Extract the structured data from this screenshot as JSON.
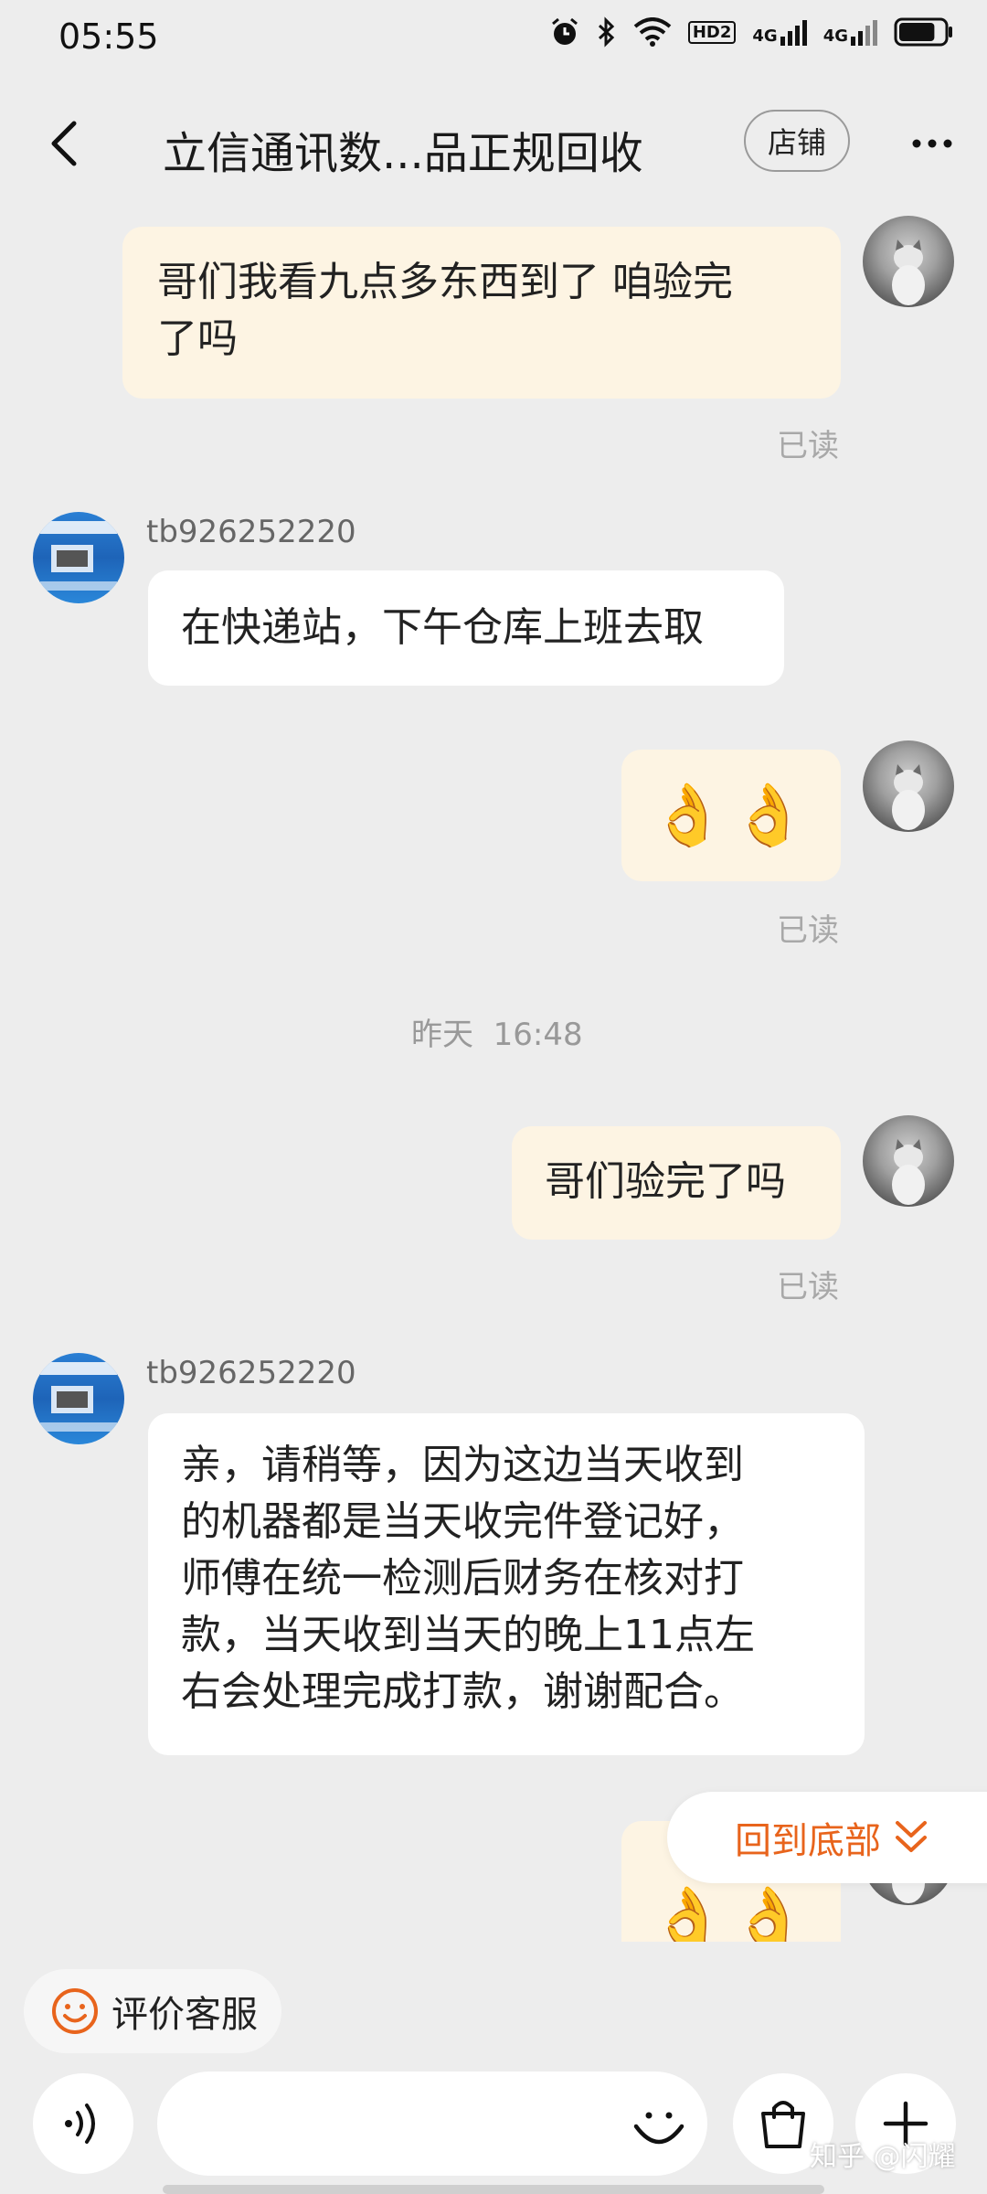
{
  "status_bar": {
    "time": "05:55",
    "network_labels": [
      "HD2",
      "4G",
      "4G"
    ],
    "battery_level": 0.8
  },
  "header": {
    "title": "立信通讯数...品正规回收",
    "store_label": "店铺",
    "back_icon": "chevron-left-icon",
    "more_icon": "more-dots-icon"
  },
  "messages": [
    {
      "side": "self",
      "text": "哥们我看九点多东西到了 咱验完了吗",
      "line1": "哥们我看九点多东西到了 咱验完",
      "line2": "了吗",
      "read": "已读"
    },
    {
      "side": "other",
      "sender": "tb926252220",
      "text": "在快递站，下午仓库上班去取"
    },
    {
      "side": "self",
      "text": "👌👌",
      "read": "已读"
    },
    {
      "side": "self",
      "text": "哥们验完了吗",
      "read": "已读"
    },
    {
      "side": "other",
      "sender": "tb926252220",
      "lines": [
        "亲，请稍等，因为这边当天收到",
        "的机器都是当天收完件登记好，",
        "师傅在统一检测后财务在核对打",
        "款，当天收到当天的晚上11点左",
        "右会处理完成打款，谢谢配合。"
      ]
    },
    {
      "side": "self",
      "text": "👌👌"
    }
  ],
  "time_divider": "昨天  16:48",
  "read_label": "已读",
  "back_to_bottom": {
    "label": "回到底部",
    "icon": "double-chevron-down-icon"
  },
  "rate_service": {
    "label": "评价客服",
    "icon": "smiley-icon"
  },
  "input_bar": {
    "voice_icon": "voice-icon",
    "emoji_icon": "emoji-icon",
    "bag_icon": "shopping-bag-icon",
    "plus_icon": "plus-icon"
  },
  "watermark": "知乎 @闪耀",
  "colors": {
    "background": "#ededed",
    "self_bubble": "#fdf4e3",
    "other_bubble": "#ffffff",
    "accent": "#e8641c"
  }
}
